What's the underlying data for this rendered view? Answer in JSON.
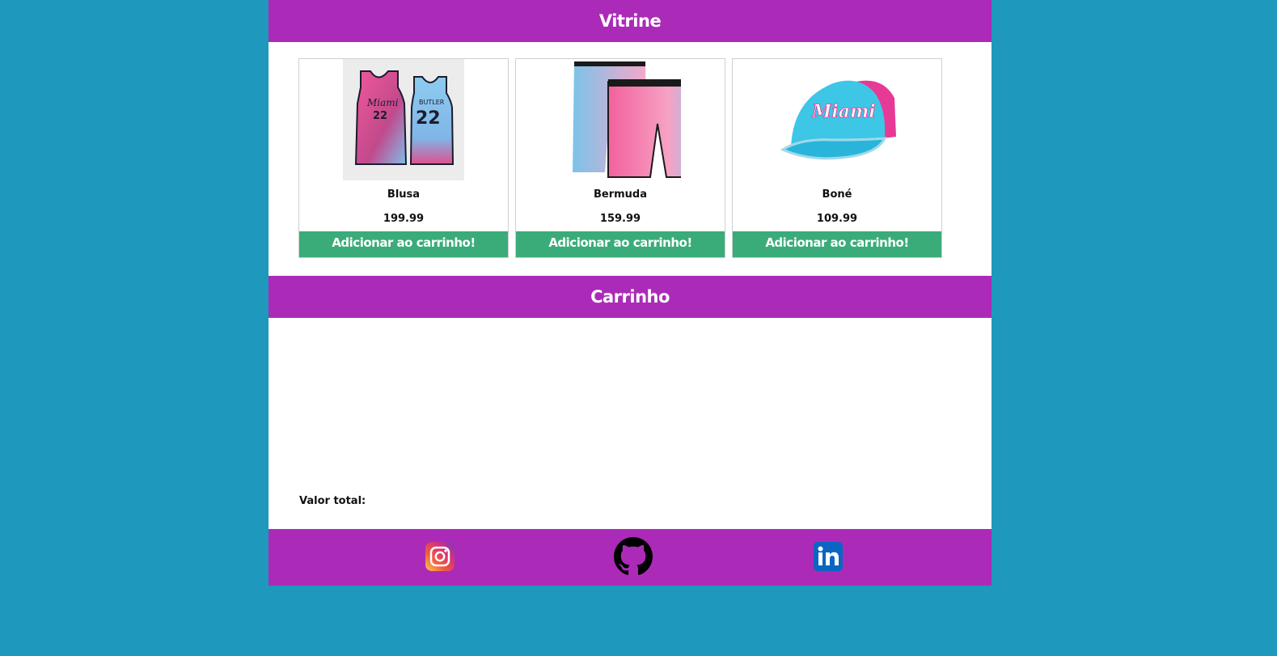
{
  "vitrine": {
    "title": "Vitrine",
    "products": [
      {
        "name": "Blusa",
        "price": "199.99",
        "button_label": "Adicionar ao carrinho!",
        "image": "jersey-image"
      },
      {
        "name": "Bermuda",
        "price": "159.99",
        "button_label": "Adicionar ao carrinho!",
        "image": "shorts-image"
      },
      {
        "name": "Boné",
        "price": "109.99",
        "button_label": "Adicionar ao carrinho!",
        "image": "cap-image"
      }
    ]
  },
  "carrinho": {
    "title": "Carrinho",
    "items": [],
    "total_label": "Valor total:"
  },
  "footer": {
    "links": [
      {
        "icon": "instagram-icon"
      },
      {
        "icon": "github-icon"
      },
      {
        "icon": "linkedin-icon"
      }
    ]
  },
  "colors": {
    "background": "#1e98bc",
    "header": "#ab2bb8",
    "button": "#3aac7a",
    "panel": "#ffffff"
  }
}
